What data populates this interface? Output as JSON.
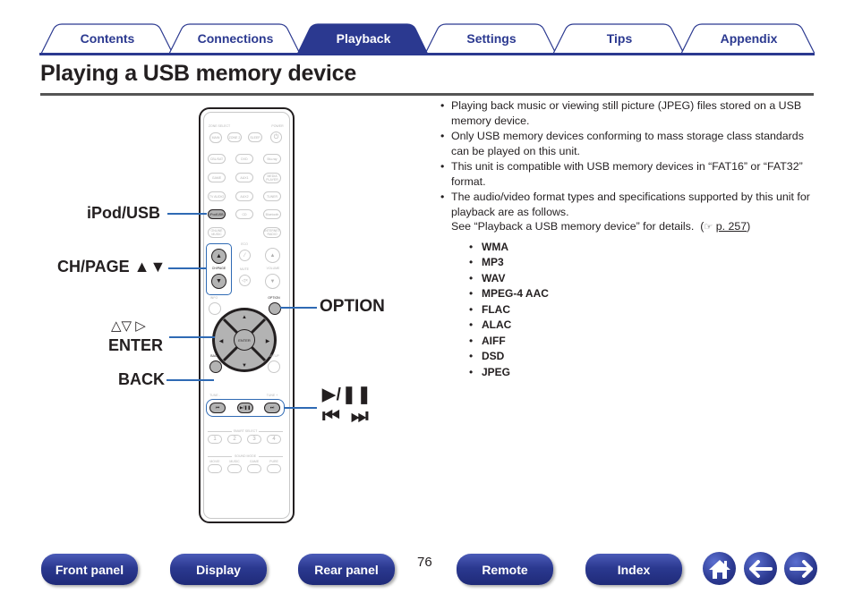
{
  "tabs": [
    {
      "label": "Contents",
      "active": false
    },
    {
      "label": "Connections",
      "active": false
    },
    {
      "label": "Playback",
      "active": true
    },
    {
      "label": "Settings",
      "active": false
    },
    {
      "label": "Tips",
      "active": false
    },
    {
      "label": "Appendix",
      "active": false
    }
  ],
  "colors": {
    "brand": "#2b3990",
    "highlight": "#2f6ab4",
    "rule": "#555555"
  },
  "page": {
    "title": "Playing a USB memory device",
    "number": "76"
  },
  "content": {
    "bullets": [
      "Playing back music or viewing still picture (JPEG) files stored on a USB memory device.",
      "Only USB memory devices conforming to mass storage class standards can be played on this unit.",
      "This unit is compatible with USB memory devices in “FAT16” or “FAT32” format.",
      "The audio/video format types and specifications supported by this unit for playback are as follows."
    ],
    "see_text": "See “Playback a USB memory device” for details.",
    "see_ref_open": "(",
    "see_ref_icon": "☞",
    "see_ref_link": "p. 257",
    "see_ref_close": ")",
    "formats": [
      "WMA",
      "MP3",
      "WAV",
      "MPEG-4 AAC",
      "FLAC",
      "ALAC",
      "AIFF",
      "DSD",
      "JPEG"
    ]
  },
  "callouts": {
    "ipod_usb": "iPod/USB",
    "ch_page": "CH/PAGE ▲▼",
    "arrows": "△▽ ▷",
    "enter": "ENTER",
    "back": "BACK",
    "option": "OPTION",
    "play_pause": "▶/❚❚",
    "skip": "⏮ ⏭"
  },
  "remote": {
    "zone_select": "ZONE SELECT",
    "power": "POWER",
    "buttons_row1": [
      "MAIN",
      "ZONE 2",
      "SLEEP"
    ],
    "buttons_row2": [
      "CBL/SAT",
      "DVD",
      "Blu-ray"
    ],
    "buttons_row3": [
      "GAME",
      "AUX1",
      "MEDIA PLAYER"
    ],
    "buttons_row4": [
      "TV AUDIO",
      "AUX2",
      "TUNER"
    ],
    "buttons_row5": [
      "iPod/USB",
      "CD",
      "Bluetooth"
    ],
    "buttons_row6": [
      "ONLINE MUSIC",
      "INTERNET RADIO"
    ],
    "eco": "ECO",
    "ch_page": "CH/PAGE",
    "mute": "MUTE",
    "volume": "VOLUME",
    "info": "INFO",
    "option": "OPTION",
    "enter": "ENTER",
    "back": "BACK",
    "setup": "SETUP",
    "tune_minus": "TUNE -",
    "tune_plus": "TUNE +",
    "transport": [
      "⏮",
      "▶/❚❚",
      "⏭"
    ],
    "smart_select": "SMART SELECT",
    "smart_buttons": [
      "1",
      "2",
      "3",
      "4"
    ],
    "sound_mode": "SOUND MODE",
    "sound_buttons": [
      "MOVIE",
      "MUSIC",
      "GAME",
      "PURE"
    ]
  },
  "bottom_nav": {
    "front_panel": "Front panel",
    "display": "Display",
    "rear_panel": "Rear panel",
    "remote": "Remote",
    "index": "Index"
  }
}
